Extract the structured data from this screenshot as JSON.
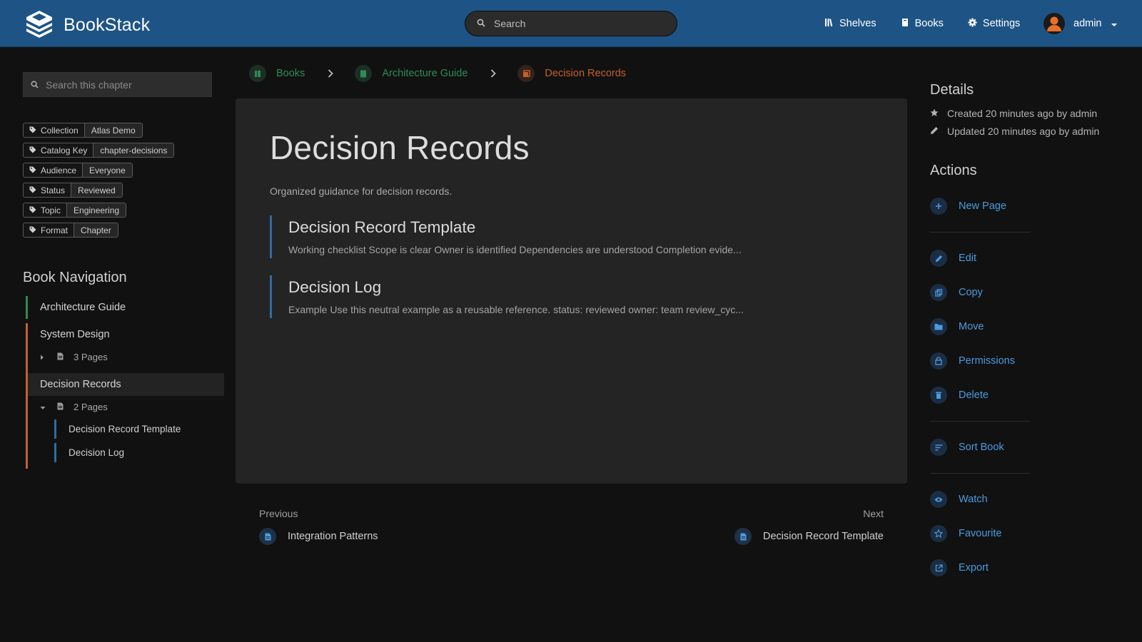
{
  "header": {
    "app_name": "BookStack",
    "search_placeholder": "Search",
    "nav": [
      {
        "label": "Shelves",
        "icon": "shelves-icon"
      },
      {
        "label": "Books",
        "icon": "book-icon"
      },
      {
        "label": "Settings",
        "icon": "gear-icon"
      }
    ],
    "user": {
      "name": "admin"
    }
  },
  "sidebar": {
    "search_placeholder": "Search this chapter",
    "tags": [
      {
        "name": "Collection",
        "value": "Atlas Demo"
      },
      {
        "name": "Catalog Key",
        "value": "chapter-decisions"
      },
      {
        "name": "Audience",
        "value": "Everyone"
      },
      {
        "name": "Status",
        "value": "Reviewed"
      },
      {
        "name": "Topic",
        "value": "Engineering"
      },
      {
        "name": "Format",
        "value": "Chapter"
      }
    ],
    "book_nav_title": "Book Navigation",
    "book": "Architecture Guide",
    "chapters": [
      {
        "name": "System Design",
        "pages_label": "3 Pages"
      },
      {
        "name": "Decision Records",
        "pages_label": "2 Pages",
        "pages": [
          "Decision Record Template",
          "Decision Log"
        ]
      }
    ]
  },
  "breadcrumb": [
    {
      "label": "Books",
      "color": "#2e8b57"
    },
    {
      "label": "Architecture Guide",
      "color": "#2e8b57"
    },
    {
      "label": "Decision Records",
      "color": "#c2612e"
    }
  ],
  "main": {
    "title": "Decision Records",
    "description": "Organized guidance for decision records.",
    "entries": [
      {
        "title": "Decision Record Template",
        "excerpt": "Working checklist Scope is clear Owner is identified Dependencies are understood Completion evide..."
      },
      {
        "title": "Decision Log",
        "excerpt": "Example Use this neutral example as a reusable reference. status: reviewed owner: team review_cyc..."
      }
    ]
  },
  "prevnext": {
    "prev_label": "Previous",
    "prev_title": "Integration Patterns",
    "next_label": "Next",
    "next_title": "Decision Record Template"
  },
  "details": {
    "title": "Details",
    "created": "Created 20 minutes ago by admin",
    "updated": "Updated 20 minutes ago by admin"
  },
  "actions": {
    "title": "Actions",
    "new_page": "New Page",
    "edit": "Edit",
    "copy": "Copy",
    "move": "Move",
    "permissions": "Permissions",
    "delete": "Delete",
    "sort_book": "Sort Book",
    "watch": "Watch",
    "favourite": "Favourite",
    "export": "Export"
  },
  "colors": {
    "header": "#1e5485",
    "book": "#2e8b57",
    "chapter": "#c2612e",
    "page": "#2e6da4",
    "link": "#4a9be0"
  }
}
